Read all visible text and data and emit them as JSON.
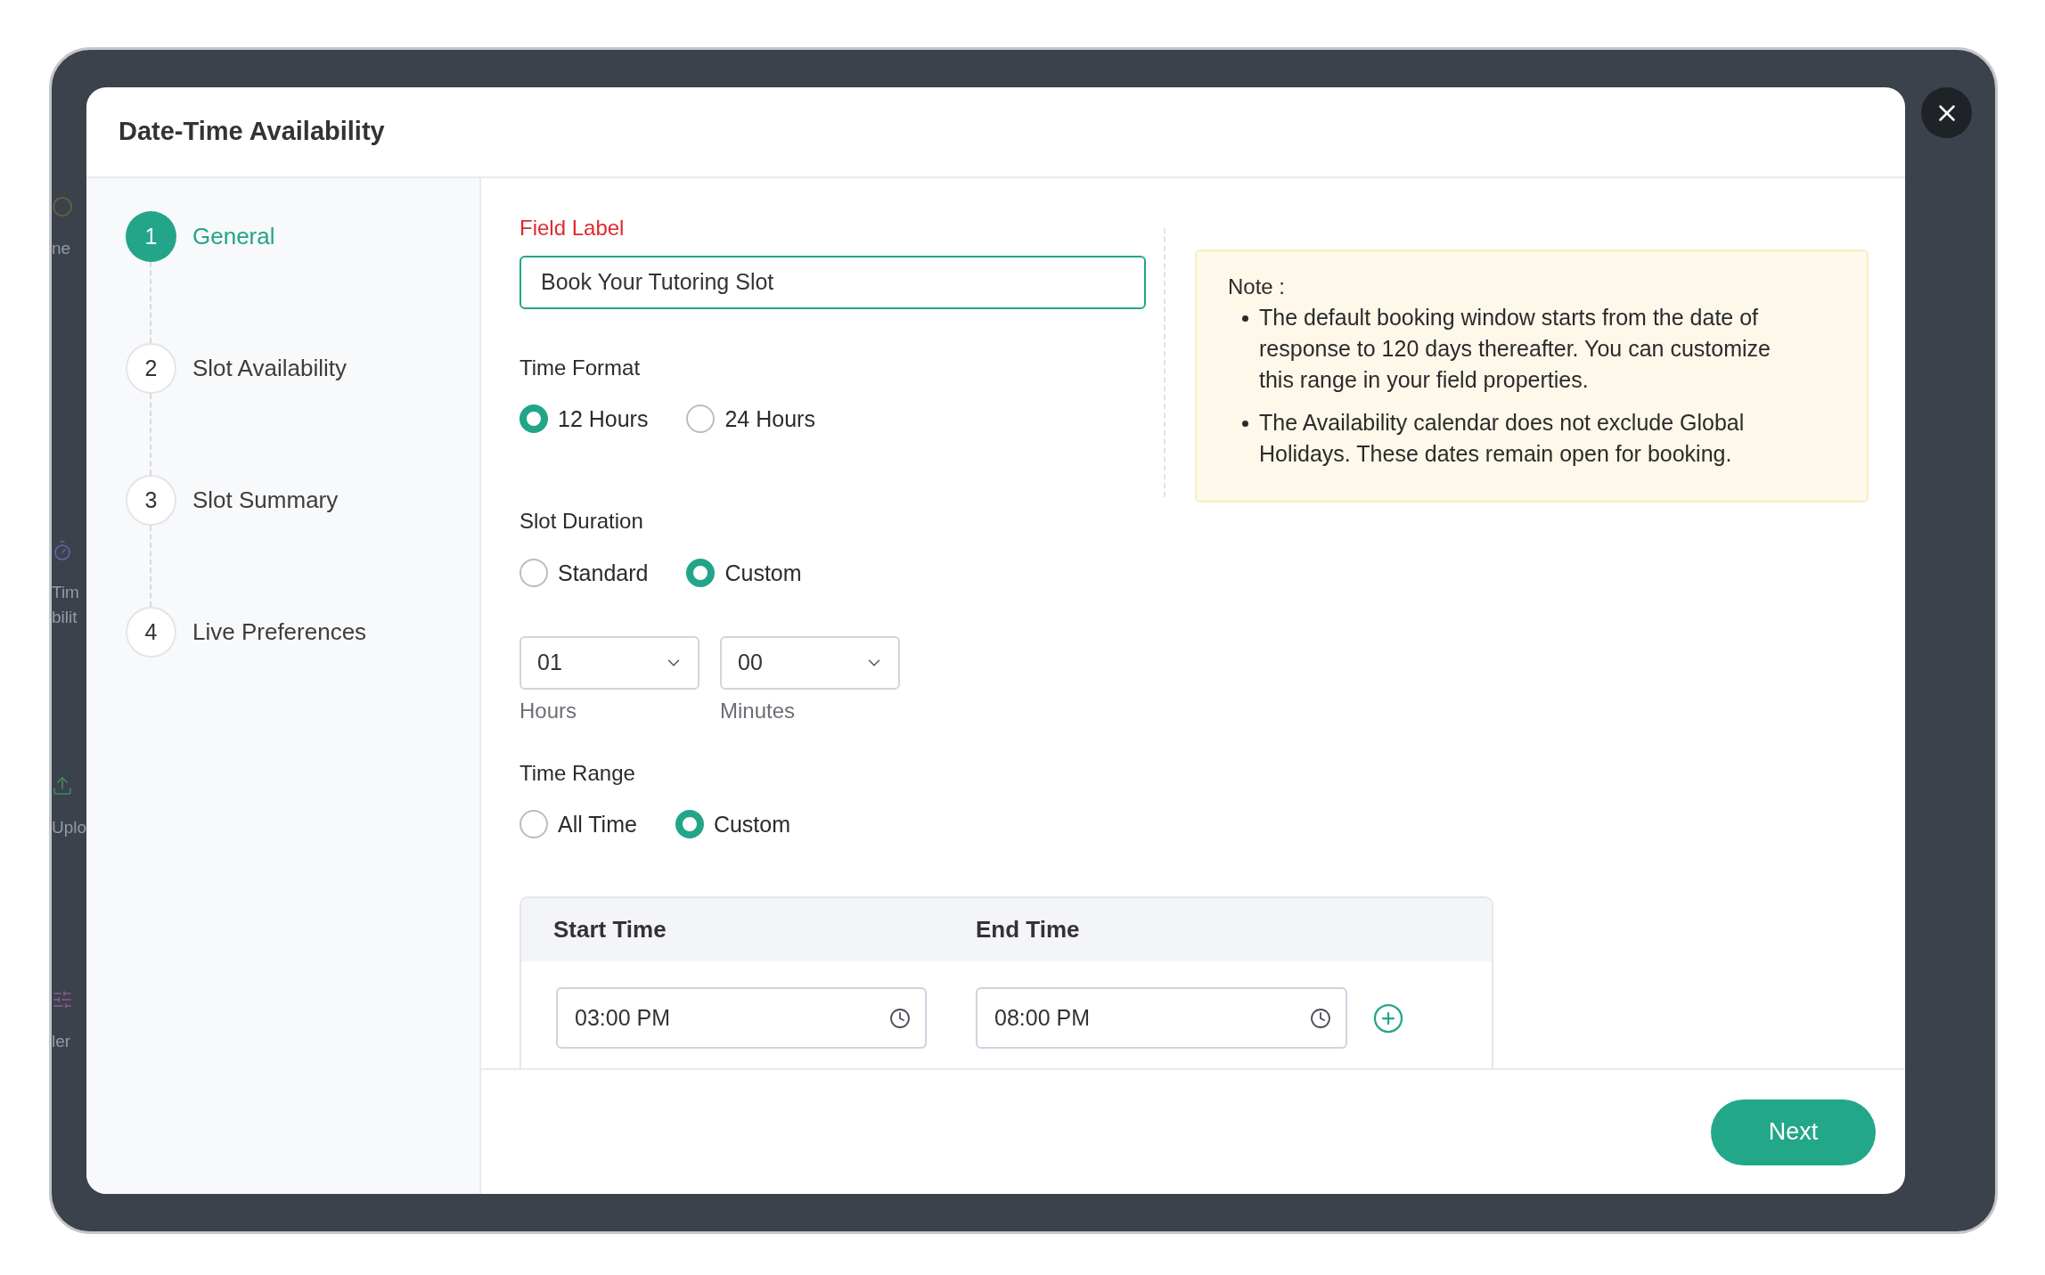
{
  "background_tiles": [
    {
      "labels": [
        "ne"
      ]
    },
    {
      "labels": [
        "Tim",
        "bilit"
      ]
    },
    {
      "labels": [
        "Uplo"
      ]
    },
    {
      "labels": [
        "ler"
      ]
    }
  ],
  "dialog": {
    "title": "Date-Time Availability"
  },
  "steps": [
    {
      "number": "1",
      "label": "General",
      "selected": true
    },
    {
      "number": "2",
      "label": "Slot Availability",
      "selected": false
    },
    {
      "number": "3",
      "label": "Slot Summary",
      "selected": false
    },
    {
      "number": "4",
      "label": "Live Preferences",
      "selected": false
    }
  ],
  "form": {
    "field_label": {
      "label": "Field Label",
      "value": "Book Your Tutoring Slot",
      "focused": true
    },
    "time_format": {
      "label": "Time Format",
      "options": [
        {
          "label": "12 Hours",
          "selected": true
        },
        {
          "label": "24 Hours",
          "selected": false
        }
      ]
    },
    "slot_duration": {
      "label": "Slot Duration",
      "options": [
        {
          "label": "Standard",
          "selected": false
        },
        {
          "label": "Custom",
          "selected": true
        }
      ],
      "selects": [
        {
          "value": "01",
          "caption": "Hours"
        },
        {
          "value": "00",
          "caption": "Minutes"
        }
      ]
    },
    "time_range": {
      "label": "Time Range",
      "options": [
        {
          "label": "All Time",
          "selected": false
        },
        {
          "label": "Custom",
          "selected": true
        }
      ]
    },
    "time_table": {
      "columns": [
        "Start Time",
        "End Time"
      ],
      "rows": [
        {
          "start": "03:00 PM",
          "end": "08:00 PM"
        }
      ]
    }
  },
  "note": {
    "title": "Note :",
    "items": [
      "The default booking window starts from the date of response to 120 days thereafter. You can customize this range in your field properties.",
      "The Availability calendar does not exclude Global Holidays. These dates remain open for booking."
    ]
  },
  "footer": {
    "next_button": "Next"
  }
}
